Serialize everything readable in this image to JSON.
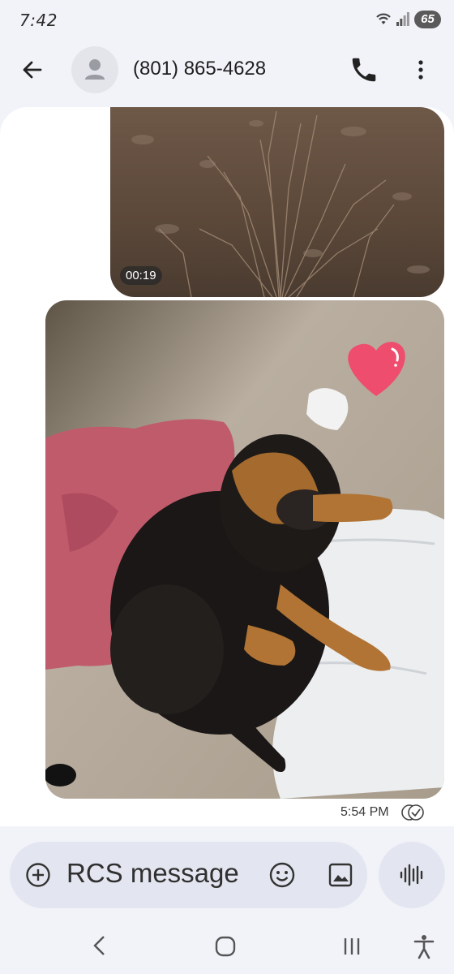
{
  "status_bar": {
    "time": "7:42",
    "battery": "65"
  },
  "header": {
    "contact": "(801) 865-4628",
    "icons": [
      "back-arrow-icon",
      "contact-avatar-icon",
      "phone-icon",
      "more-vert-icon"
    ]
  },
  "messages": [
    {
      "type": "video",
      "duration": "00:19"
    },
    {
      "type": "image",
      "description_icon": "dog-photo"
    }
  ],
  "meta": {
    "timestamp": "5:54 PM",
    "status_icon": "read-check-icon"
  },
  "composer": {
    "placeholder": "RCS message",
    "icons": [
      "add-circle-icon",
      "emoji-icon",
      "gallery-icon",
      "voice-icon"
    ]
  },
  "nav": {
    "icons": [
      "nav-back-icon",
      "nav-home-icon",
      "nav-recents-icon",
      "accessibility-icon"
    ]
  },
  "colors": {
    "background": "#f2f3f9",
    "composer": "#e3e6f0",
    "heart": "#ee4d6d"
  }
}
